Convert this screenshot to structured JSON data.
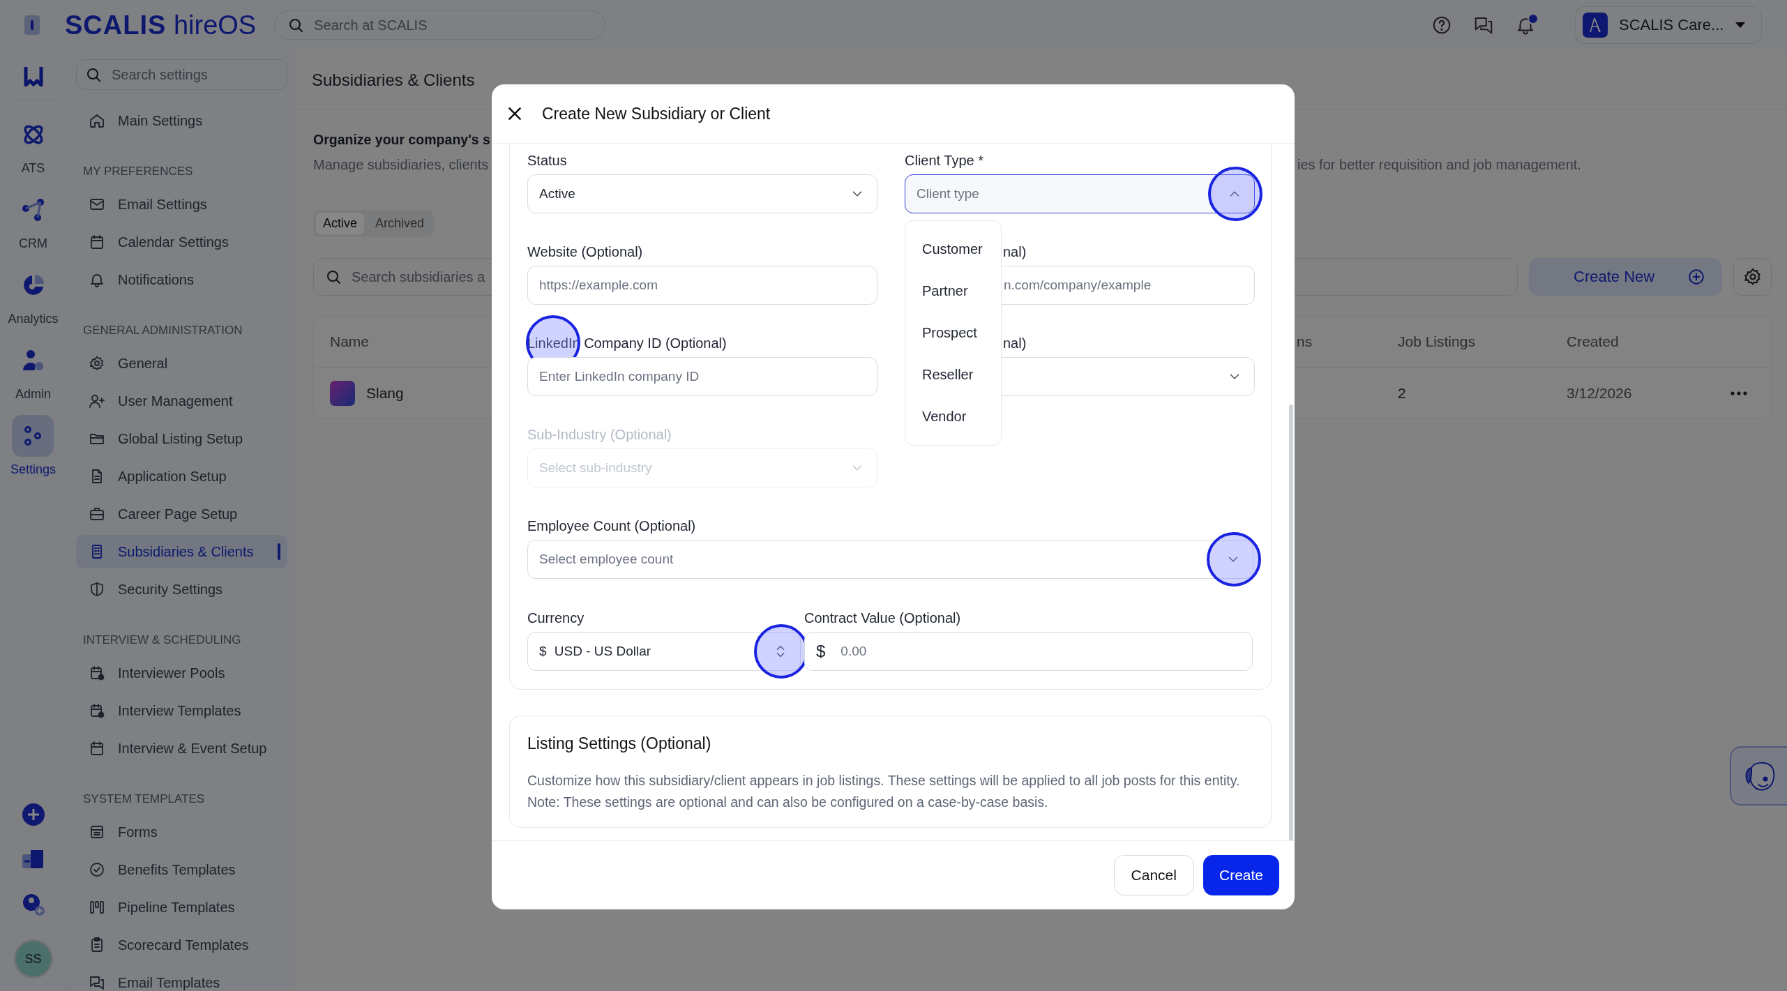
{
  "topbar": {
    "brand": "SCALIS",
    "product": "hireOS",
    "search": {
      "placeholder": "Search at SCALIS"
    },
    "notifications_unread": true,
    "account": {
      "name": "SCALIS Care..."
    }
  },
  "rail": {
    "items": [
      {
        "label": "ATS",
        "selected": false
      },
      {
        "label": "CRM",
        "selected": false
      },
      {
        "label": "Analytics",
        "selected": false
      },
      {
        "label": "Admin",
        "selected": false
      },
      {
        "label": "Settings",
        "selected": true
      }
    ],
    "user": {
      "initials": "SS"
    }
  },
  "settings_sidebar": {
    "search": {
      "placeholder": "Search settings"
    },
    "main": {
      "label": "Main Settings",
      "selected": false
    },
    "sections": [
      {
        "title": "MY PREFERENCES",
        "items": [
          {
            "label": "Email Settings",
            "selected": false
          },
          {
            "label": "Calendar Settings",
            "selected": false
          },
          {
            "label": "Notifications",
            "selected": false
          }
        ]
      },
      {
        "title": "GENERAL ADMINISTRATION",
        "items": [
          {
            "label": "General",
            "selected": false
          },
          {
            "label": "User Management",
            "selected": false
          },
          {
            "label": "Global Listing Setup",
            "selected": false
          },
          {
            "label": "Application Setup",
            "selected": false
          },
          {
            "label": "Career Page Setup",
            "selected": false
          },
          {
            "label": "Subsidiaries & Clients",
            "selected": true
          },
          {
            "label": "Security Settings",
            "selected": false
          }
        ]
      },
      {
        "title": "INTERVIEW & SCHEDULING",
        "items": [
          {
            "label": "Interviewer Pools",
            "selected": false
          },
          {
            "label": "Interview Templates",
            "selected": false
          },
          {
            "label": "Interview & Event Setup",
            "selected": false
          }
        ]
      },
      {
        "title": "SYSTEM TEMPLATES",
        "items": [
          {
            "label": "Forms",
            "selected": false
          },
          {
            "label": "Benefits Templates",
            "selected": false
          },
          {
            "label": "Pipeline Templates",
            "selected": false
          },
          {
            "label": "Scorecard Templates",
            "selected": false
          },
          {
            "label": "Email Templates",
            "selected": false
          }
        ]
      }
    ]
  },
  "page": {
    "title": "Subsidiaries & Clients",
    "intro": "Organize your company's s",
    "description": "Manage subsidiaries, clients",
    "description_end": "ies for better requisition and job management.",
    "tabs": [
      {
        "label": "Active",
        "selected": true
      },
      {
        "label": "Archived",
        "selected": false
      }
    ],
    "search": {
      "placeholder": "Search subsidiaries a"
    },
    "create_button": "Create New",
    "table": {
      "columns": [
        "Name",
        "ns",
        "Job Listings",
        "Created"
      ],
      "rows": [
        {
          "name": "Slang",
          "job_listings": "2",
          "created": "3/12/2026"
        }
      ]
    }
  },
  "modal": {
    "title": "Create New Subsidiary or Client",
    "fields": [
      {
        "kind": "select",
        "label": "Status",
        "value": "Active",
        "expanded": false,
        "disabled": false
      },
      {
        "kind": "select",
        "label": "Client Type *",
        "placeholder": "Client type",
        "expanded": true,
        "disabled": false,
        "options": [
          {
            "label": "Customer",
            "selected": false
          },
          {
            "label": "Partner",
            "selected": false
          },
          {
            "label": "Prospect",
            "selected": false
          },
          {
            "label": "Reseller",
            "selected": false
          },
          {
            "label": "Vendor",
            "selected": false
          }
        ]
      },
      {
        "kind": "input",
        "label": "Website (Optional)",
        "placeholder": "https://example.com",
        "disabled": false
      },
      {
        "kind": "input",
        "label": "nal)",
        "placeholder": "n.com/company/example",
        "disabled": false
      },
      {
        "kind": "input",
        "label": "LinkedIn Company ID (Optional)",
        "placeholder": "Enter LinkedIn company ID",
        "disabled": false
      },
      {
        "kind": "select",
        "label": "nal)",
        "expanded": false,
        "disabled": false
      },
      {
        "kind": "select",
        "label": "Sub-Industry (Optional)",
        "placeholder": "Select sub-industry",
        "expanded": false,
        "disabled": true
      }
    ],
    "employee_count": {
      "label": "Employee Count (Optional)",
      "placeholder": "Select employee count",
      "expanded": false
    },
    "currency": {
      "label": "Currency",
      "symbol": "$",
      "value": "USD - US Dollar"
    },
    "contract_value": {
      "label": "Contract Value (Optional)",
      "symbol": "$",
      "placeholder": "0.00"
    },
    "listing_settings": {
      "title": "Listing Settings (Optional)",
      "description": "Customize how this subsidiary/client appears in job listings. These settings will be applied to all job posts for this entity. Note: These settings are optional and can also be configured on a case-by-case basis."
    },
    "buttons": [
      {
        "label": "Cancel",
        "kind": "secondary"
      },
      {
        "label": "Create",
        "kind": "primary"
      }
    ]
  }
}
